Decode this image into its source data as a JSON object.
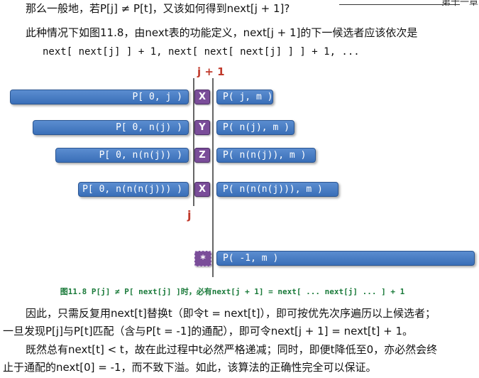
{
  "top_fragment": "第十一章",
  "question": "那么一般地，若P[j] ≠ P[t]，又该如何得到next[j + 1]?",
  "intro_line1": "此种情况下如图11.8，由next表的功能定义，next[j + 1]的下一候选者应该依次是",
  "intro_line2": "next[ next[j] ] + 1, next[ next[ next[j] ] ] + 1, ...",
  "figure": {
    "top_label": "j + 1",
    "bottom_label": "j",
    "rows": [
      {
        "left": "P[ 0, j )",
        "mark": "X",
        "right": "P( j, m )"
      },
      {
        "left": "P[ 0, n(j) )",
        "mark": "Y",
        "right": "P( n(j), m )"
      },
      {
        "left": "P[ 0, n(n(j)) )",
        "mark": "Z",
        "right": "P( n(n(j)), m )"
      },
      {
        "left": "P[ 0, n(n(n(j))) )",
        "mark": "X",
        "right": "P( n(n(n(j))), m )"
      }
    ],
    "sentinel": {
      "mark": "*",
      "right": "P( -1, m )"
    },
    "caption": "图11.8 P[j] ≠ P[ next[j] ]时，必有next[j + 1] = next[ ... next[j] ... ] + 1"
  },
  "para1_line1": "因此，只需反复用next[t]替换t（即令t = next[t]），即可按优先次序遍历以上候选者；",
  "para1_line2": "一旦发现P[j]与P[t]匹配（含与P[t = -1]的通配），即可令next[j + 1] = next[t] + 1。",
  "para2_line1": "既然总有next[t] < t，故在此过程中t必然严格递减；同时，即便t降低至0，亦必然会终",
  "para2_line2": "止于通配的next[0] = -1，而不致下溢。如此，该算法的正确性完全可以保证。"
}
